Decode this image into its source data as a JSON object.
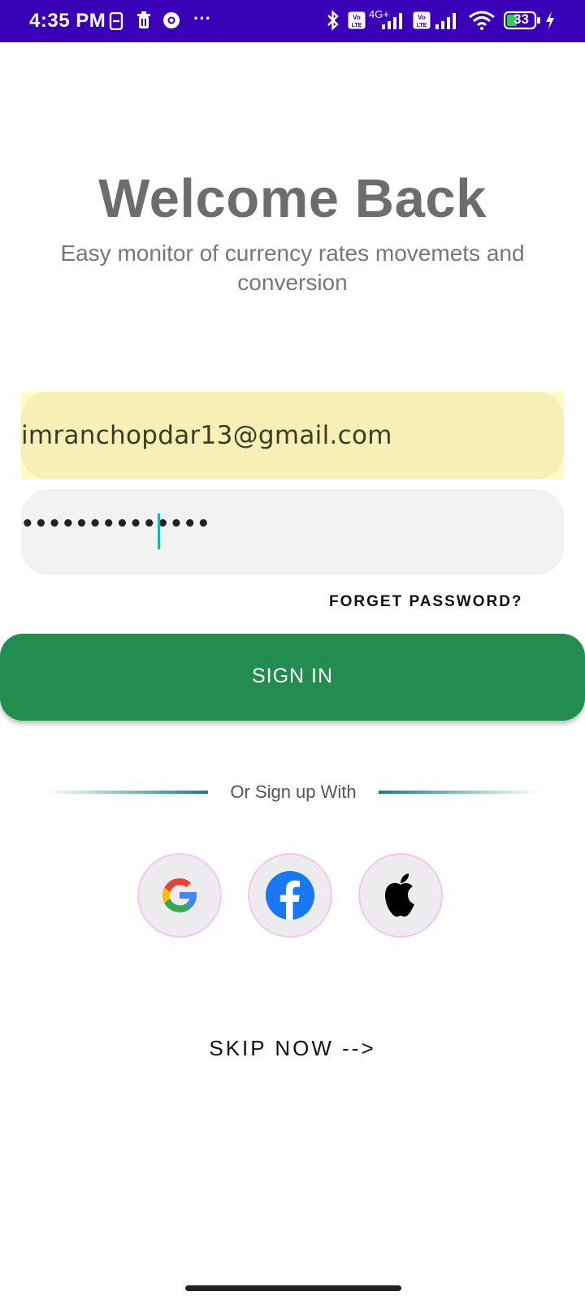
{
  "status_bar": {
    "time": "4:35 PM",
    "more": "···",
    "battery": "33",
    "left_icons": [
      "sim-card-icon",
      "trash-icon",
      "chrome-icon"
    ],
    "right_icons": [
      "bluetooth-icon",
      "volte-icon",
      "signal-icon",
      "wifi-icon",
      "battery-icon",
      "charging-icon"
    ],
    "network_label": "4G+",
    "volte_label": "Vo LTE"
  },
  "header": {
    "title": "Welcome Back",
    "subtitle": "Easy monitor of currency rates movemets and conversion"
  },
  "form": {
    "email_value": "imranchopdar13@gmail.com",
    "password_mask": "••••••••••••••",
    "forget_password": "FORGET PASSWORD?",
    "sign_in": "SIGN IN"
  },
  "social": {
    "divider_text": "Or Sign up With",
    "buttons": [
      "google-icon",
      "facebook-icon",
      "apple-icon"
    ]
  },
  "skip": "SKIP NOW -->",
  "colors": {
    "status_bar": "#3a00b8",
    "title": "#6d6d6d",
    "sign_in_button": "#228d4f",
    "email_field": "#f7f0b6",
    "password_field": "#f2f2f2",
    "divider": "#1c8075",
    "caret": "#16b5b0"
  }
}
